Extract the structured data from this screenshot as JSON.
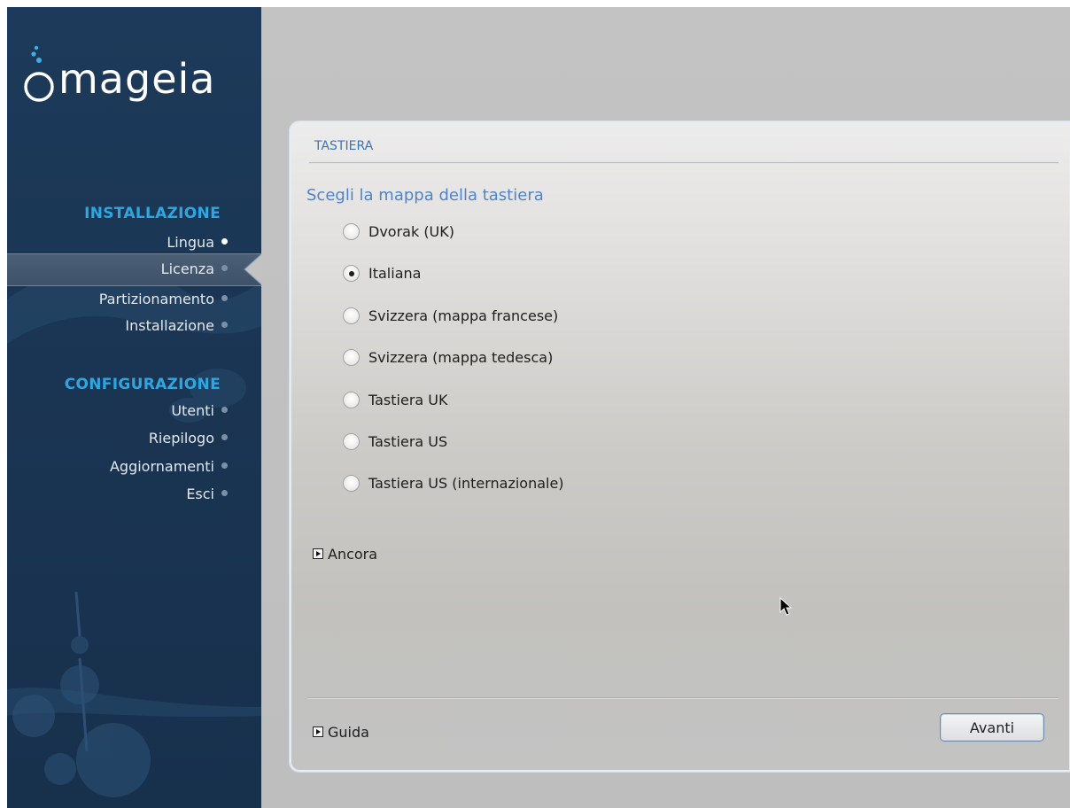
{
  "sidebar": {
    "logo_text": "mageia",
    "sections": [
      {
        "title": "INSTALLAZIONE",
        "steps": [
          {
            "label": "Lingua",
            "state": "done"
          },
          {
            "label": "Licenza",
            "state": "current"
          },
          {
            "label": "Partizionamento",
            "state": "pending"
          },
          {
            "label": "Installazione",
            "state": "pending"
          }
        ]
      },
      {
        "title": "CONFIGURAZIONE",
        "steps": [
          {
            "label": "Utenti",
            "state": "pending"
          },
          {
            "label": "Riepilogo",
            "state": "pending"
          },
          {
            "label": "Aggiornamenti",
            "state": "pending"
          },
          {
            "label": "Esci",
            "state": "pending"
          }
        ]
      }
    ]
  },
  "panel": {
    "title": "TASTIERA",
    "question": "Scegli la mappa della tastiera",
    "options": [
      {
        "label": "Dvorak (UK)",
        "selected": false
      },
      {
        "label": "Italiana",
        "selected": true
      },
      {
        "label": "Svizzera (mappa francese)",
        "selected": false
      },
      {
        "label": "Svizzera (mappa tedesca)",
        "selected": false
      },
      {
        "label": "Tastiera UK",
        "selected": false
      },
      {
        "label": "Tastiera US",
        "selected": false
      },
      {
        "label": "Tastiera US (internazionale)",
        "selected": false
      }
    ],
    "more_label": "Ancora",
    "help_label": "Guida",
    "next_label": "Avanti"
  },
  "colors": {
    "sidebar_bg": "#1a3553",
    "section_title": "#2fa6e0",
    "panel_title": "#3b74b8",
    "question": "#4f84c6"
  }
}
